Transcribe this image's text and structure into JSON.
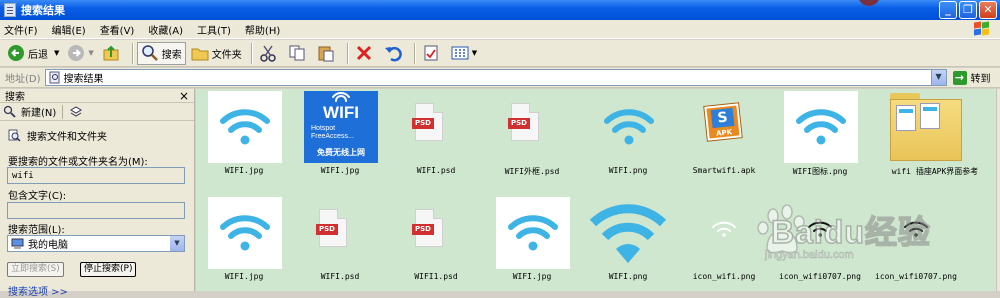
{
  "window": {
    "title": "搜索结果"
  },
  "menu": [
    "文件(F)",
    "编辑(E)",
    "查看(V)",
    "收藏(A)",
    "工具(T)",
    "帮助(H)"
  ],
  "toolbar": {
    "back": "后退",
    "search": "搜索",
    "folders": "文件夹"
  },
  "address": {
    "label": "地址(D)",
    "value": "搜索结果",
    "go": "转到"
  },
  "sidebar": {
    "title": "搜索",
    "close": "×",
    "new_label": "新建(N)",
    "section_title": "搜索文件和文件夹",
    "name_label": "要搜索的文件或文件夹名为(M):",
    "name_value": "wifi",
    "contains_label": "包含文字(C):",
    "contains_value": "",
    "scope_label": "搜索范围(L):",
    "scope_value": "我的电脑",
    "search_now": "立即搜索(S)",
    "stop_search": "停止搜索(P)",
    "options": "搜索选项 >>"
  },
  "files": [
    {
      "name": "WIFI.jpg",
      "type": "wifi"
    },
    {
      "name": "WIFI.jpg",
      "type": "wifi-blue"
    },
    {
      "name": "WIFI.psd",
      "type": "psd"
    },
    {
      "name": "WIFI外框.psd",
      "type": "psd"
    },
    {
      "name": "WIFI.png",
      "type": "wifi-plain"
    },
    {
      "name": "Smartwifi.apk",
      "type": "apk"
    },
    {
      "name": "WIFI图标.png",
      "type": "wifi"
    },
    {
      "name": "wifi 插座APK界面参考",
      "type": "folder"
    },
    {
      "name": "WIFI.jpg",
      "type": "wifi"
    },
    {
      "name": "WIFI.psd",
      "type": "psd"
    },
    {
      "name": "WIFI1.psd",
      "type": "psd"
    },
    {
      "name": "WIFI.jpg",
      "type": "wifi"
    },
    {
      "name": "WIFI.png",
      "type": "wifi-big"
    },
    {
      "name": "icon_wifi.png",
      "type": "wifi-small-white"
    },
    {
      "name": "icon_wifi0707.png",
      "type": "wifi-small-black"
    },
    {
      "name": "icon_wifi0707.png",
      "type": "wifi-small-black"
    }
  ],
  "thumb_text": {
    "wifi_brand": "WIFI",
    "hotspot": "Hotspot",
    "free_access": "FreeAccess...",
    "free_online": "免费无线上网",
    "psd": "PSD",
    "apk": "APK"
  },
  "watermark": {
    "brand": "Baidu经验",
    "url": "jingyan.baidu.com"
  },
  "colors": {
    "wifi": "#3db3e6",
    "content_bg": "#cfe6cf",
    "titlebar": "#0a5ee6"
  }
}
